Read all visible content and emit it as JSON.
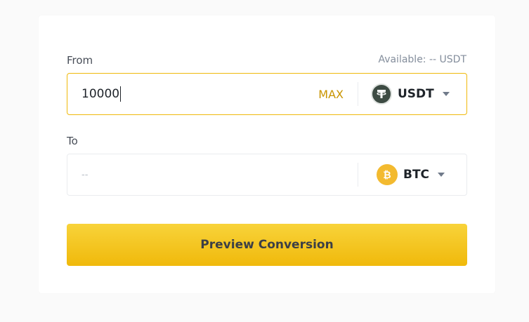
{
  "from": {
    "label": "From",
    "available": "Available: -- USDT",
    "amount": "10000",
    "max_label": "MAX",
    "coin": {
      "symbol": "USDT",
      "icon": "usdt-coin-icon",
      "color": "#3d4b43"
    }
  },
  "to": {
    "label": "To",
    "amount_placeholder": "--",
    "coin": {
      "symbol": "BTC",
      "icon": "btc-coin-icon",
      "color": "#f3ba2f"
    }
  },
  "action": {
    "preview_label": "Preview Conversion"
  },
  "colors": {
    "accent": "#f0b90b",
    "max_text": "#c99400"
  }
}
